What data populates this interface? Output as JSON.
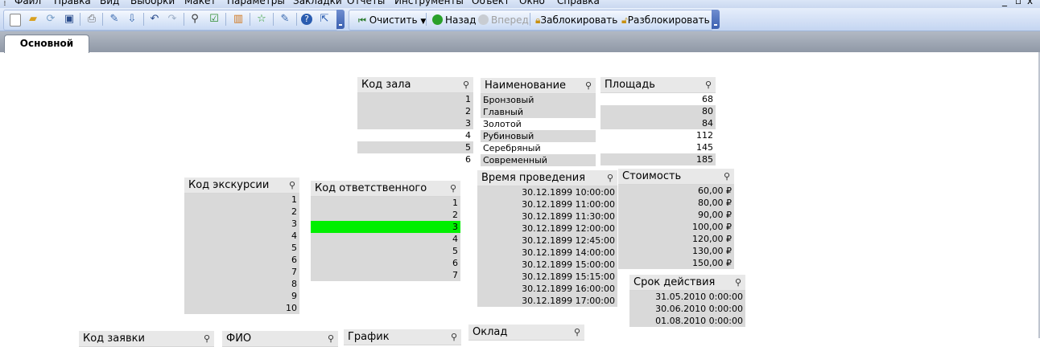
{
  "menu": {
    "items": [
      "Файл",
      "Правка",
      "Вид",
      "Выборки",
      "Макет",
      "Параметры",
      "Закладки",
      "Отчеты",
      "Инструменты",
      "Объект",
      "Окно",
      "Справка"
    ],
    "window_controls": [
      "_",
      "▫",
      "x"
    ]
  },
  "toolbar": {
    "clear_label": "Очистить",
    "back_label": "Назад",
    "forward_label": "Вперед",
    "lock_label": "Заблокировать",
    "unlock_label": "Разблокировать"
  },
  "tabs": [
    {
      "label": "Основной",
      "active": true
    }
  ],
  "listboxes": {
    "kod_zala": {
      "title": "Код зала",
      "rows": [
        "1",
        "2",
        "3",
        "4",
        "5",
        "6"
      ],
      "states": [
        "gray",
        "gray",
        "gray",
        "white",
        "gray",
        "white"
      ]
    },
    "naimenovanie": {
      "title": "Наименование",
      "rows": [
        "Бронзовый",
        "Главный",
        "Золотой",
        "Рубиновый",
        "Серебряный",
        "Современный"
      ],
      "states": [
        "gray",
        "gray",
        "white",
        "gray",
        "white",
        "gray"
      ]
    },
    "ploshad": {
      "title": "Площадь",
      "rows": [
        "68",
        "80",
        "84",
        "112",
        "145",
        "185"
      ],
      "states": [
        "white",
        "gray",
        "gray",
        "white",
        "white",
        "gray"
      ]
    },
    "kod_ekskursii": {
      "title": "Код экскурсии",
      "rows": [
        "1",
        "2",
        "3",
        "4",
        "5",
        "6",
        "7",
        "8",
        "9",
        "10"
      ]
    },
    "kod_otvetstvennogo": {
      "title": "Код ответственного",
      "rows": [
        "1",
        "2",
        "3",
        "4",
        "5",
        "6",
        "7"
      ],
      "selected": "3"
    },
    "vremya": {
      "title": "Время проведения",
      "rows": [
        "30.12.1899 10:00:00",
        "30.12.1899 11:00:00",
        "30.12.1899 11:30:00",
        "30.12.1899 12:00:00",
        "30.12.1899 12:45:00",
        "30.12.1899 14:00:00",
        "30.12.1899 15:00:00",
        "30.12.1899 15:15:00",
        "30.12.1899 16:00:00",
        "30.12.1899 17:00:00"
      ]
    },
    "stoimost": {
      "title": "Стоимость",
      "rows": [
        "60,00 ₽",
        "80,00 ₽",
        "90,00 ₽",
        "100,00 ₽",
        "120,00 ₽",
        "130,00 ₽",
        "150,00 ₽"
      ]
    },
    "srok": {
      "title": "Срок действия",
      "rows": [
        "31.05.2010 0:00:00",
        "30.06.2010 0:00:00",
        "01.08.2010 0:00:00"
      ]
    },
    "kod_zayavki": {
      "title": "Код заявки"
    },
    "fio": {
      "title": "ФИО"
    },
    "grafik": {
      "title": "График"
    },
    "oklad": {
      "title": "Оклад"
    }
  },
  "colors": {
    "selected": "#00f000",
    "alternative": "#d9d9d9",
    "possible": "#ffffff",
    "caption": "#e8e8e8"
  }
}
